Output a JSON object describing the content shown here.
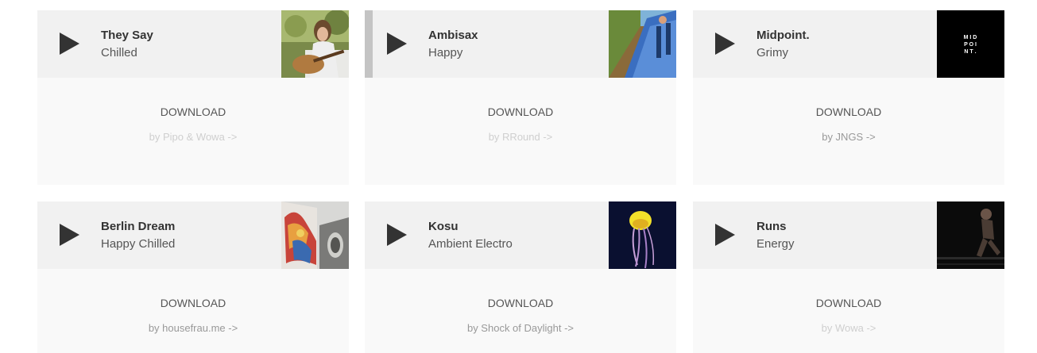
{
  "tracks": [
    {
      "title": "They Say",
      "genre": "Chilled",
      "download_label": "DOWNLOAD",
      "author_link": "by Pipo & Wowa ->",
      "thumb": "girl-playing-guitar-photo"
    },
    {
      "title": "Ambisax",
      "genre": "Happy",
      "download_label": "DOWNLOAD",
      "author_link": "by RRound ->",
      "thumb": "train-photo"
    },
    {
      "title": "Midpoint.",
      "genre": "Grimy",
      "download_label": "DOWNLOAD",
      "author_link": "by JNGS ->",
      "thumb": "midpoint-logo",
      "thumb_text": [
        "M I D",
        "P O I",
        "N T ."
      ]
    },
    {
      "title": "Berlin Dream",
      "genre": "Happy Chilled",
      "download_label": "DOWNLOAD",
      "author_link": "by housefrau.me ->",
      "thumb": "graffiti-wall-photo"
    },
    {
      "title": "Kosu",
      "genre": "Ambient Electro",
      "download_label": "DOWNLOAD",
      "author_link": "by Shock of Daylight ->",
      "thumb": "jellyfish-photo"
    },
    {
      "title": "Runs",
      "genre": "Energy",
      "download_label": "DOWNLOAD",
      "author_link": "by Wowa ->",
      "thumb": "runner-photo"
    }
  ],
  "colors": {
    "header_bg": "#f1f1f1",
    "body_bg": "#f9f9f9",
    "play": "#333333",
    "active_bar": "#c4c4c4"
  }
}
